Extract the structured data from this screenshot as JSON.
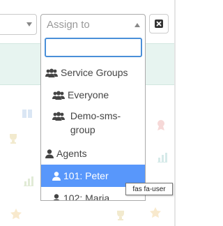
{
  "assign_select": {
    "placeholder": "Assign to"
  },
  "search": {
    "value": ""
  },
  "dropdown": {
    "groups": [
      {
        "label": "Service Groups",
        "icon": "users-icon",
        "items": [
          {
            "label": "Everyone",
            "icon": "users-icon"
          },
          {
            "label": "Demo-sms-group",
            "icon": "users-icon"
          }
        ]
      },
      {
        "label": "Agents",
        "icon": "user-icon",
        "items": [
          {
            "label": "101: Peter",
            "icon": "user-icon",
            "highlighted": true
          },
          {
            "label": "102: Maria",
            "icon": "user-icon"
          }
        ]
      }
    ],
    "highlight_color": "#5897fb"
  },
  "tooltip": {
    "text": "fas fa-user"
  },
  "colors": {
    "focus_border": "#4a8fd8",
    "info_band": "#e7f4f0"
  }
}
